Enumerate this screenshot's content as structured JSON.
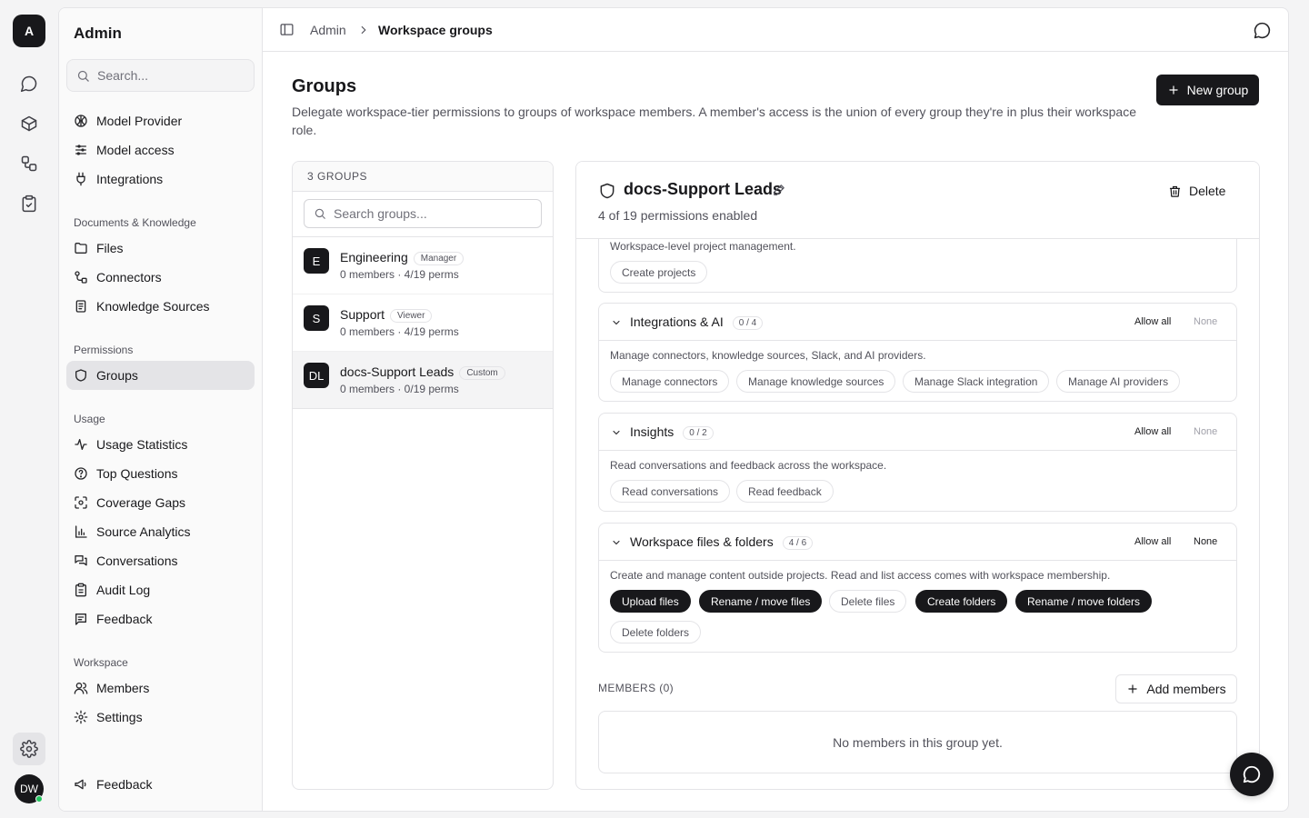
{
  "rail": {
    "logo": "A",
    "avatar": "DW"
  },
  "sidebar": {
    "title": "Admin",
    "search_placeholder": "Search...",
    "top_items": [
      {
        "label": "Model Provider",
        "icon": "brain-icon"
      },
      {
        "label": "Model access",
        "icon": "sliders-icon"
      },
      {
        "label": "Integrations",
        "icon": "plug-icon"
      }
    ],
    "sections": [
      {
        "title": "Documents & Knowledge",
        "items": [
          {
            "label": "Files",
            "icon": "folder-icon"
          },
          {
            "label": "Connectors",
            "icon": "connector-icon"
          },
          {
            "label": "Knowledge Sources",
            "icon": "book-icon"
          }
        ]
      },
      {
        "title": "Permissions",
        "items": [
          {
            "label": "Groups",
            "icon": "shield-icon"
          }
        ]
      },
      {
        "title": "Usage",
        "items": [
          {
            "label": "Usage Statistics",
            "icon": "activity-icon"
          },
          {
            "label": "Top Questions",
            "icon": "help-circle-icon"
          },
          {
            "label": "Coverage Gaps",
            "icon": "scan-icon"
          },
          {
            "label": "Source Analytics",
            "icon": "bar-chart-icon"
          },
          {
            "label": "Conversations",
            "icon": "messages-icon"
          },
          {
            "label": "Audit Log",
            "icon": "clipboard-icon"
          },
          {
            "label": "Feedback",
            "icon": "message-square-icon"
          }
        ]
      },
      {
        "title": "Workspace",
        "items": [
          {
            "label": "Members",
            "icon": "users-icon"
          },
          {
            "label": "Settings",
            "icon": "gear-icon"
          }
        ]
      }
    ],
    "footer_feedback": "Feedback"
  },
  "topbar": {
    "crumb_root": "Admin",
    "crumb_current": "Workspace groups"
  },
  "page": {
    "title": "Groups",
    "description": "Delegate workspace-tier permissions to groups of workspace members. A member's access is the union of every group they're in plus their workspace role.",
    "new_group_label": "New group"
  },
  "groups_panel": {
    "count_label": "3 GROUPS",
    "search_placeholder": "Search groups...",
    "groups": [
      {
        "initials": "E",
        "name": "Engineering",
        "badge": "Manager",
        "meta": "0 members · 4/19 perms",
        "selected": false
      },
      {
        "initials": "S",
        "name": "Support",
        "badge": "Viewer",
        "meta": "0 members · 4/19 perms",
        "selected": false
      },
      {
        "initials": "DL",
        "name": "docs-Support Leads",
        "badge": "Custom",
        "meta": "0 members · 0/19 perms",
        "selected": true
      }
    ]
  },
  "detail": {
    "name": "docs-Support Leads",
    "subtitle": "4 of 19 permissions enabled",
    "delete_label": "Delete",
    "allow_all_label": "Allow all",
    "none_label": "None",
    "partial_card": {
      "description": "Workspace-level project management.",
      "chips": [
        {
          "label": "Create projects",
          "on": false
        }
      ]
    },
    "cards": [
      {
        "title": "Integrations & AI",
        "count": "0 / 4",
        "none_active": false,
        "description": "Manage connectors, knowledge sources, Slack, and AI providers.",
        "chips": [
          {
            "label": "Manage connectors",
            "on": false
          },
          {
            "label": "Manage knowledge sources",
            "on": false
          },
          {
            "label": "Manage Slack integration",
            "on": false
          },
          {
            "label": "Manage AI providers",
            "on": false
          }
        ]
      },
      {
        "title": "Insights",
        "count": "0 / 2",
        "none_active": false,
        "description": "Read conversations and feedback across the workspace.",
        "chips": [
          {
            "label": "Read conversations",
            "on": false
          },
          {
            "label": "Read feedback",
            "on": false
          }
        ]
      },
      {
        "title": "Workspace files & folders",
        "count": "4 / 6",
        "none_active": true,
        "description": "Create and manage content outside projects. Read and list access comes with workspace membership.",
        "chips": [
          {
            "label": "Upload files",
            "on": true
          },
          {
            "label": "Rename / move files",
            "on": true
          },
          {
            "label": "Delete files",
            "on": false
          },
          {
            "label": "Create folders",
            "on": true
          },
          {
            "label": "Rename / move folders",
            "on": true
          },
          {
            "label": "Delete folders",
            "on": false
          }
        ]
      }
    ],
    "members_label": "MEMBERS (0)",
    "add_members_label": "Add members",
    "members_empty": "No members in this group yet."
  }
}
